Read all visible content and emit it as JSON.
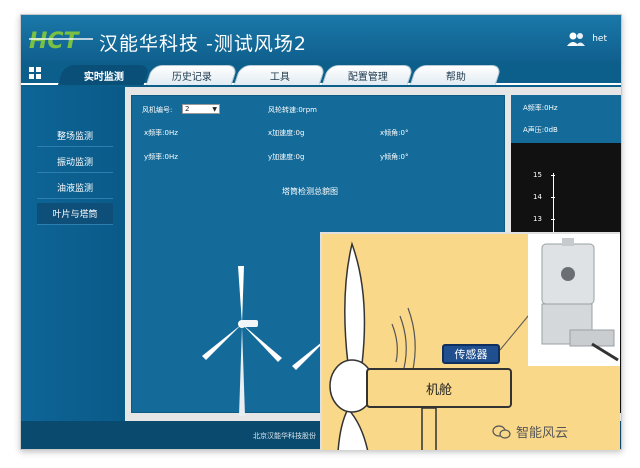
{
  "header": {
    "logo_text": "HCT",
    "title": "汉能华科技  -测试风场2",
    "username": "het"
  },
  "tabs": [
    {
      "label": "实时监测",
      "active": true
    },
    {
      "label": "历史记录",
      "active": false
    },
    {
      "label": "工具",
      "active": false
    },
    {
      "label": "配置管理",
      "active": false
    },
    {
      "label": "帮助",
      "active": false
    }
  ],
  "sidebar": {
    "items": [
      {
        "label": "整场监测"
      },
      {
        "label": "振动监测"
      },
      {
        "label": "油液监测"
      },
      {
        "label": "叶片与塔筒",
        "active": true
      }
    ]
  },
  "main": {
    "fan_no_label": "风机编号:",
    "fan_no_value": "2",
    "rotor_speed": "风轮转速:0rpm",
    "x_freq": "x频率:0Hz",
    "x_accel": "x加速度:0g",
    "x_tilt": "x倾角:0°",
    "y_freq": "y频率:0Hz",
    "y_accel": "y加速度:0g",
    "y_tilt": "y倾角:0°",
    "tower_title": "塔筒检测总貌图"
  },
  "right_panel": {
    "a_freq": "A频率:0Hz",
    "a_sound": "A声压:0dB",
    "yticks": [
      "15",
      "14",
      "13"
    ]
  },
  "footer": {
    "text": "北京汉能华科技股份"
  },
  "overlay": {
    "sensor_label": "传感器",
    "nacelle_label": "机舱",
    "watermark": "智能风云"
  },
  "colors": {
    "header_blue": "#1a78a8",
    "panel_blue": "#146a98",
    "logo_green": "#7ac142",
    "overlay_yellow": "#f9d889"
  }
}
